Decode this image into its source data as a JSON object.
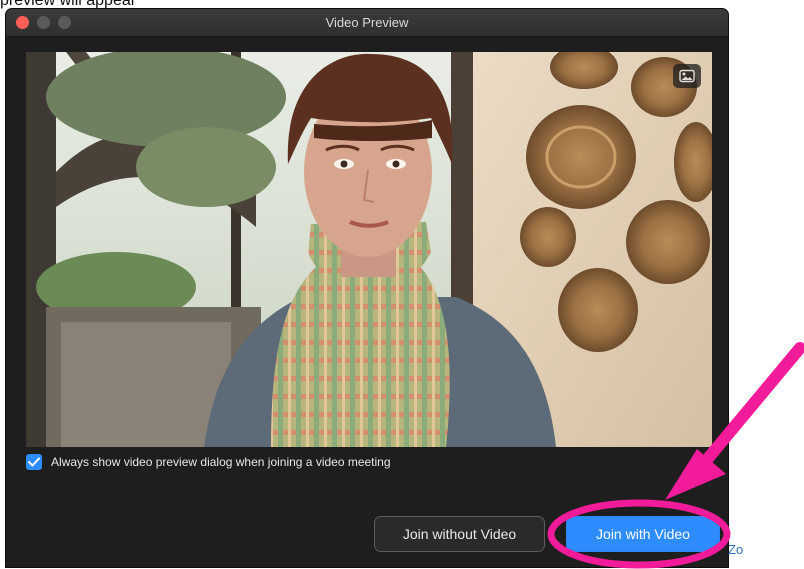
{
  "app": {
    "title": "Video Preview",
    "top_text": "preview will appear"
  },
  "preview": {
    "checkbox_label": "Always show video preview dialog when joining a video meeting",
    "checkbox_checked": true
  },
  "buttons": {
    "join_without_video": "Join without Video",
    "join_with_video": "Join with Video"
  },
  "side_fragment": "Zo",
  "colors": {
    "accent": "#2d8cff",
    "annotation": "#f21b9a",
    "close": "#ff5f57"
  },
  "icons": [
    "background-image-icon",
    "check-icon",
    "arrow-annotation"
  ]
}
